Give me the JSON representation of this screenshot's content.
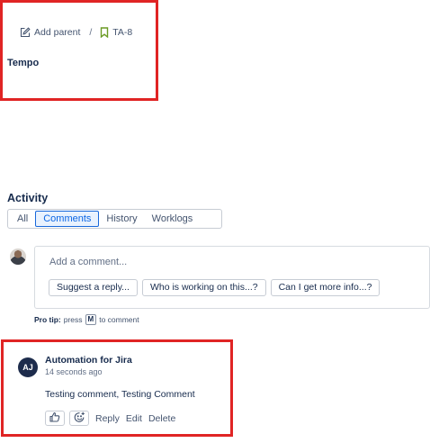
{
  "breadcrumb": {
    "add_parent_label": "Add parent",
    "separator": "/",
    "issue_key": "TA-8",
    "issue_key_color": "#6a9a23"
  },
  "issue": {
    "title": "Tempo"
  },
  "activity": {
    "heading": "Activity",
    "tabs": [
      {
        "label": "All",
        "active": false
      },
      {
        "label": "Comments",
        "active": true
      },
      {
        "label": "History",
        "active": false
      },
      {
        "label": "Worklogs",
        "active": false
      }
    ]
  },
  "comment_editor": {
    "placeholder": "Add a comment...",
    "suggestions": [
      "Suggest a reply...",
      "Who is working on this...?",
      "Can I get more info...?"
    ]
  },
  "pro_tip": {
    "prefix": "Pro tip:",
    "press": "press",
    "key": "M",
    "suffix": "to comment"
  },
  "comment": {
    "avatar_initials": "AJ",
    "author": "Automation for Jira",
    "timestamp": "14 seconds ago",
    "body": "Testing comment, Testing Comment",
    "actions": {
      "reply": "Reply",
      "edit": "Edit",
      "delete": "Delete"
    }
  },
  "colors": {
    "annotation_box": "#e02424",
    "active_tab": "#0c66e4",
    "avatar_bg": "#1d2c4c"
  }
}
